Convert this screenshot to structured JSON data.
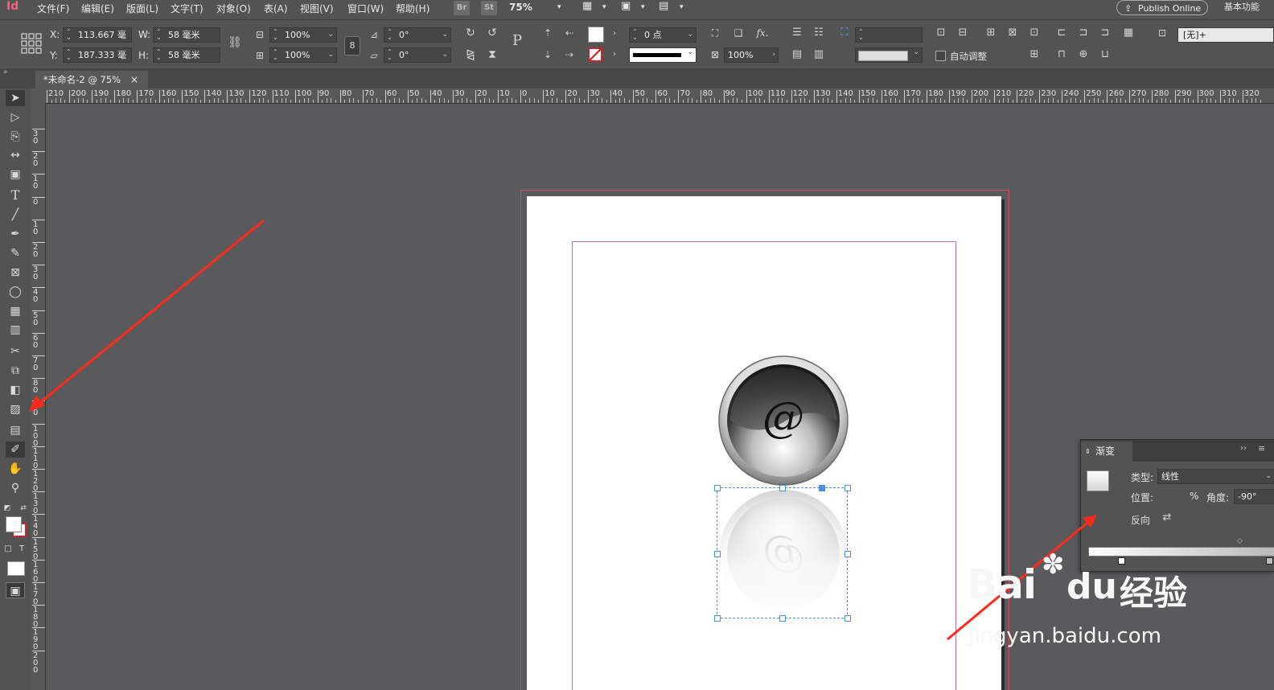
{
  "app": {
    "logo": "Id"
  },
  "menu": {
    "items": [
      "文件(F)",
      "编辑(E)",
      "版面(L)",
      "文字(T)",
      "对象(O)",
      "表(A)",
      "视图(V)",
      "窗口(W)",
      "帮助(H)"
    ],
    "bridge": "Br",
    "stock": "St",
    "zoom": "75%",
    "publish": "Publish Online",
    "workspace": "基本功能"
  },
  "controls": {
    "x_label": "X:",
    "x_value": "113.667 毫",
    "y_label": "Y:",
    "y_value": "187.333 毫",
    "w_label": "W:",
    "w_value": "58 毫米",
    "h_label": "H:",
    "h_value": "58 毫米",
    "scale_x": "100%",
    "scale_y": "100%",
    "rotate": "0°",
    "shear": "0°",
    "stroke_weight": "0 点",
    "opacity": "100%",
    "auto_fit": "自动调整",
    "object_style": "[无]+"
  },
  "tab": {
    "title": "*未命名-2 @ 75%",
    "close": "×"
  },
  "ruler": {
    "h_labels": [
      "210",
      "200",
      "190",
      "180",
      "170",
      "160",
      "150",
      "140",
      "130",
      "120",
      "110",
      "100",
      "90",
      "80",
      "70",
      "60",
      "50",
      "40",
      "30",
      "20",
      "10",
      "0",
      "10",
      "20",
      "30",
      "40",
      "50",
      "60",
      "70",
      "80",
      "90",
      "100",
      "110",
      "120",
      "130",
      "140",
      "150",
      "160",
      "170",
      "180",
      "190",
      "200",
      "210",
      "220",
      "230",
      "240",
      "250",
      "260",
      "270",
      "280",
      "290",
      "300",
      "310",
      "320"
    ],
    "v_labels": [
      "30",
      "20",
      "10",
      "0",
      "10",
      "20",
      "30",
      "40",
      "50",
      "60",
      "70",
      "80",
      "90",
      "100",
      "110",
      "120",
      "130",
      "140",
      "150",
      "160",
      "170",
      "180",
      "190",
      "200"
    ]
  },
  "artwork": {
    "symbol": "@"
  },
  "gradient_panel": {
    "title": "渐变",
    "type_label": "类型:",
    "type_value": "线性",
    "position_label": "位置:",
    "position_unit": "%",
    "angle_label": "角度:",
    "angle_value": "-90°",
    "reverse_label": "反向"
  },
  "watermark": {
    "brand": "Bai",
    "brand2": "du",
    "cn": "经验",
    "url": "jingyan.baidu.com"
  },
  "colors": {
    "arrow": "#ff2a1a",
    "bleed": "#cf4d62",
    "margin": "#c56fa8",
    "selection": "#4a90e2"
  }
}
